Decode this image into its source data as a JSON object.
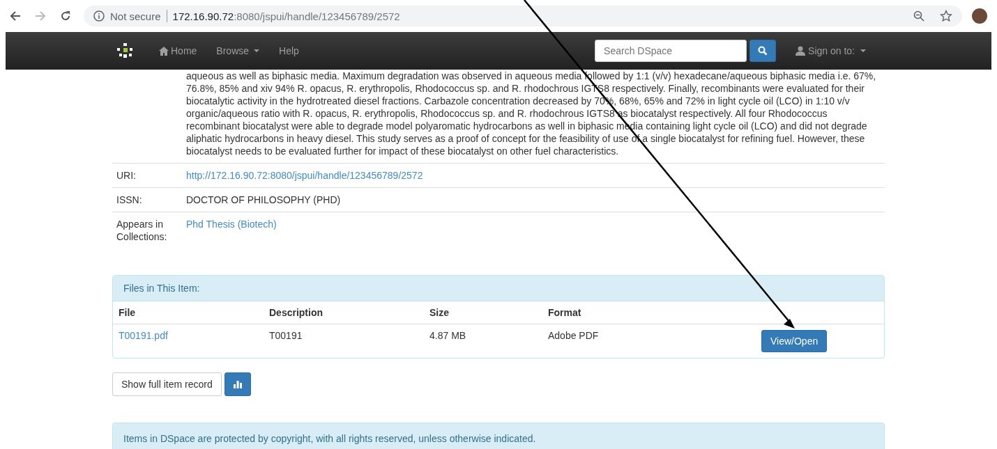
{
  "browser": {
    "security": "Not secure",
    "url_host": "172.16.90.72",
    "url_path": ":8080/jspui/handle/123456789/2572"
  },
  "navbar": {
    "items": [
      {
        "label": "Home",
        "kind": "home"
      },
      {
        "label": "Browse",
        "kind": "dropdown"
      },
      {
        "label": "Help",
        "kind": "plain"
      }
    ],
    "search": {
      "placeholder": "Search DSpace"
    },
    "sign_on": "Sign on to:"
  },
  "abstract": "aqueous as well as biphasic media. Maximum degradation was observed in aqueous media followed by 1:1 (v/v) hexadecane/aqueous biphasic media i.e. 67%, 76.8%, 85% and xiv 94% R. opacus, R. erythropolis, Rhodococcus sp. and R. rhodochrous IGTS8 respectively. Finally, recombinants were evaluated for their biocatalytic activity in the hydrotreated diesel fractions. Carbazole concentration decreased by 70%, 68%, 65% and 72% in light cycle oil (LCO) in 1:10 v/v organic/aqueous ratio with R. opacus, R. erythropolis, Rhodococcus sp. and R. rhodochrous IGTS8 as biocatalyst respectively. All four Rhodococcus recombinant biocatalyst were able to degrade model polyaromatic hydrocarbons as well in biphasic media containing light cycle oil (LCO) and did not degrade aliphatic hydrocarbons in heavy diesel. This study serves as a proof of concept for the feasibility of use of a single biocatalyst for refining fuel. However, these biocatalyst needs to be evaluated further for impact of these biocatalyst on other fuel characteristics.",
  "metadata": [
    {
      "label": "URI:",
      "value": "http://172.16.90.72:8080/jspui/handle/123456789/2572",
      "kind": "link"
    },
    {
      "label": "ISSN:",
      "value": "DOCTOR OF PHILOSOPHY (PHD)",
      "kind": "text"
    },
    {
      "label": "Appears in Collections:",
      "value": "Phd Thesis (Biotech)",
      "kind": "link"
    }
  ],
  "files": {
    "title": "Files in This Item:",
    "columns": [
      "File",
      "Description",
      "Size",
      "Format"
    ],
    "rows": [
      {
        "file": "T00191.pdf",
        "description": "T00191",
        "size": "4.87 MB",
        "format": "Adobe PDF",
        "action": "View/Open"
      }
    ]
  },
  "show_full_record": "Show full item record",
  "footer_notice": "Items in DSpace are protected by copyright, with all rights reserved, unless otherwise indicated."
}
